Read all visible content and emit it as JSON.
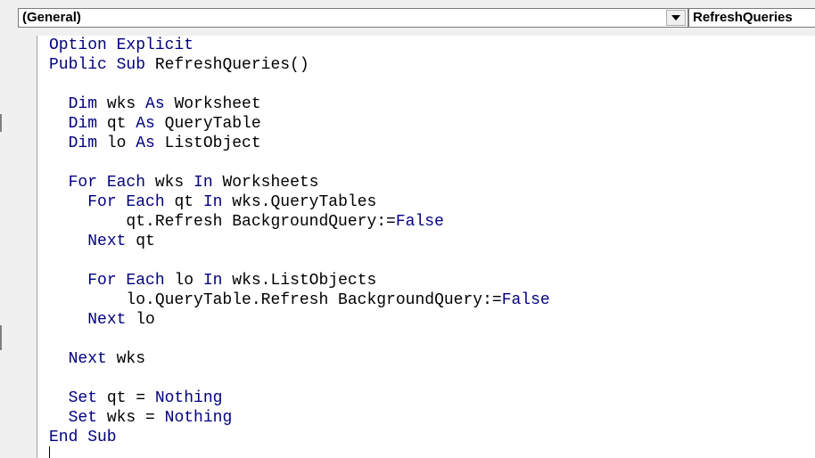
{
  "toolbar": {
    "object_combo": "(General)",
    "procedure_combo": "RefreshQueries"
  },
  "editor": {
    "lines": [
      [
        {
          "t": "Option Explicit",
          "k": true
        }
      ],
      [
        {
          "t": "Public Sub",
          "k": true
        },
        {
          "t": " RefreshQueries()",
          "k": false
        }
      ],
      [],
      [
        {
          "t": "  ",
          "k": false
        },
        {
          "t": "Dim",
          "k": true
        },
        {
          "t": " wks ",
          "k": false
        },
        {
          "t": "As",
          "k": true
        },
        {
          "t": " Worksheet",
          "k": false
        }
      ],
      [
        {
          "t": "  ",
          "k": false
        },
        {
          "t": "Dim",
          "k": true
        },
        {
          "t": " qt ",
          "k": false
        },
        {
          "t": "As",
          "k": true
        },
        {
          "t": " QueryTable",
          "k": false
        }
      ],
      [
        {
          "t": "  ",
          "k": false
        },
        {
          "t": "Dim",
          "k": true
        },
        {
          "t": " lo ",
          "k": false
        },
        {
          "t": "As",
          "k": true
        },
        {
          "t": " ListObject",
          "k": false
        }
      ],
      [],
      [
        {
          "t": "  ",
          "k": false
        },
        {
          "t": "For Each",
          "k": true
        },
        {
          "t": " wks ",
          "k": false
        },
        {
          "t": "In",
          "k": true
        },
        {
          "t": " Worksheets",
          "k": false
        }
      ],
      [
        {
          "t": "    ",
          "k": false
        },
        {
          "t": "For Each",
          "k": true
        },
        {
          "t": " qt ",
          "k": false
        },
        {
          "t": "In",
          "k": true
        },
        {
          "t": " wks.QueryTables",
          "k": false
        }
      ],
      [
        {
          "t": "        qt.Refresh BackgroundQuery:=",
          "k": false
        },
        {
          "t": "False",
          "k": true
        }
      ],
      [
        {
          "t": "    ",
          "k": false
        },
        {
          "t": "Next",
          "k": true
        },
        {
          "t": " qt",
          "k": false
        }
      ],
      [],
      [
        {
          "t": "    ",
          "k": false
        },
        {
          "t": "For Each",
          "k": true
        },
        {
          "t": " lo ",
          "k": false
        },
        {
          "t": "In",
          "k": true
        },
        {
          "t": " wks.ListObjects",
          "k": false
        }
      ],
      [
        {
          "t": "        lo.QueryTable.Refresh BackgroundQuery:=",
          "k": false
        },
        {
          "t": "False",
          "k": true
        }
      ],
      [
        {
          "t": "    ",
          "k": false
        },
        {
          "t": "Next",
          "k": true
        },
        {
          "t": " lo",
          "k": false
        }
      ],
      [],
      [
        {
          "t": "  ",
          "k": false
        },
        {
          "t": "Next",
          "k": true
        },
        {
          "t": " wks",
          "k": false
        }
      ],
      [],
      [
        {
          "t": "  ",
          "k": false
        },
        {
          "t": "Set",
          "k": true
        },
        {
          "t": " qt = ",
          "k": false
        },
        {
          "t": "Nothing",
          "k": true
        }
      ],
      [
        {
          "t": "  ",
          "k": false
        },
        {
          "t": "Set",
          "k": true
        },
        {
          "t": " wks = ",
          "k": false
        },
        {
          "t": "Nothing",
          "k": true
        }
      ],
      [
        {
          "t": "End Sub",
          "k": true
        }
      ]
    ]
  }
}
